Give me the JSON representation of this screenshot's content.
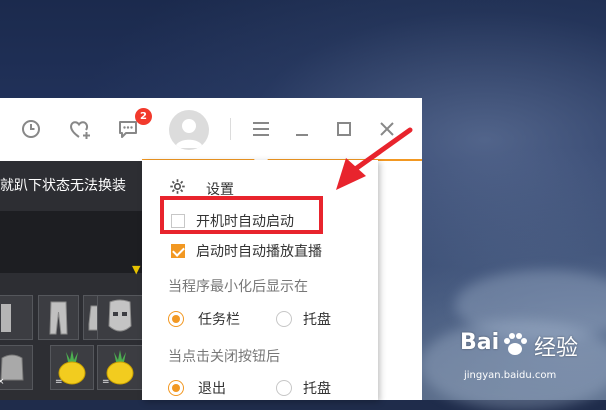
{
  "titlebar": {
    "icons": [
      "clock-icon",
      "heart-add-icon",
      "message-icon",
      "avatar",
      "menu-icon",
      "minimize-icon",
      "maximize-icon",
      "close-icon"
    ],
    "message_badge": "2"
  },
  "game_panel": {
    "title": "就趴下状态无法换装"
  },
  "menu": {
    "settings_label": "设置",
    "autostart_label": "开机时自动启动",
    "autostart_checked": false,
    "autoplay_label": "启动时自动播放直播",
    "autoplay_checked": true,
    "minimize_section": "当程序最小化后显示在",
    "minimize_options": [
      "任务栏",
      "托盘"
    ],
    "minimize_selected": "任务栏",
    "close_section": "当点击关闭按钮后",
    "close_options": [
      "退出",
      "托盘"
    ],
    "close_selected": "退出"
  },
  "watermark": {
    "brand": "Bai",
    "suffix": "经验",
    "url": "jingyan.baidu.com"
  },
  "colors": {
    "accent": "#f29822",
    "annotation": "#e8242d",
    "badge": "#f23a2c"
  }
}
